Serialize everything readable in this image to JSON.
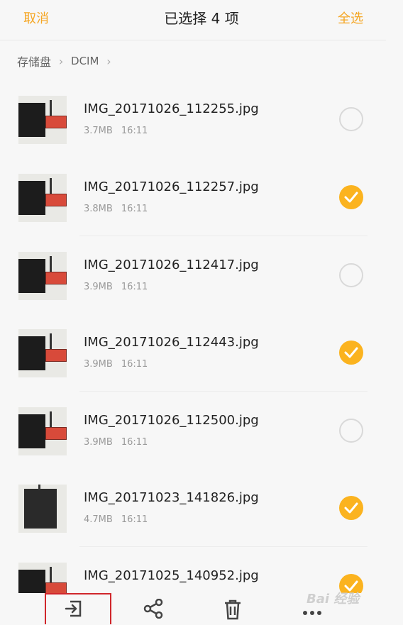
{
  "header": {
    "cancel_label": "取消",
    "title": "已选择 4 项",
    "select_all_label": "全选",
    "accent_color": "#f5a623"
  },
  "breadcrumb": {
    "items": [
      "存储盘",
      "DCIM"
    ]
  },
  "files": [
    {
      "name": "IMG_20171026_112255.jpg",
      "size": "3.7MB",
      "time": "16:11",
      "selected": false
    },
    {
      "name": "IMG_20171026_112257.jpg",
      "size": "3.8MB",
      "time": "16:11",
      "selected": true
    },
    {
      "name": "IMG_20171026_112417.jpg",
      "size": "3.9MB",
      "time": "16:11",
      "selected": false
    },
    {
      "name": "IMG_20171026_112443.jpg",
      "size": "3.9MB",
      "time": "16:11",
      "selected": true
    },
    {
      "name": "IMG_20171026_112500.jpg",
      "size": "3.9MB",
      "time": "16:11",
      "selected": false
    },
    {
      "name": "IMG_20171023_141826.jpg",
      "size": "4.7MB",
      "time": "16:11",
      "selected": true
    },
    {
      "name": "IMG_20171025_140952.jpg",
      "size": "",
      "time": "",
      "selected": true
    }
  ],
  "toolbar": {
    "icons": [
      "move-icon",
      "share-icon",
      "delete-icon",
      "more-icon"
    ]
  },
  "watermark": "Bai 经验"
}
